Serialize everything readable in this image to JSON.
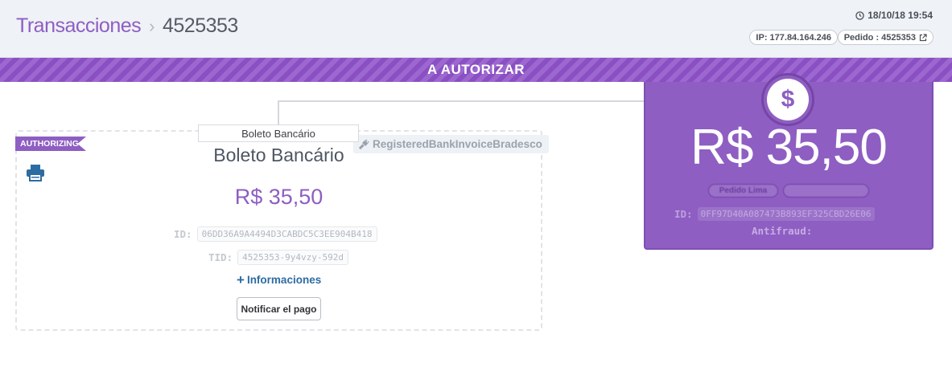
{
  "header": {
    "breadcrumb_root": "Transacciones",
    "breadcrumb_separator": "›",
    "transaction_number": "4525353",
    "datetime": "18/10/18 19:54",
    "ip_label": "IP: 177.84.164.246",
    "order_label": "Pedido : 4525353"
  },
  "status_banner": "A AUTORIZAR",
  "payment": {
    "tab_label": "Boleto Bancário",
    "status_ribbon": "AUTHORIZING",
    "provider": "RegisteredBankInvoiceBradesco",
    "method_title": "Boleto Bancário",
    "amount": "R$ 35,50",
    "id_label": "ID:",
    "id_value": "06DD36A9A4494D3CABDC5C3EE904B418",
    "tid_label": "TID:",
    "tid_value": "4525353-9y4vzy-592d",
    "more_info_label": "Informaciones",
    "notify_button_label": "Notificar el pago"
  },
  "summary": {
    "currency_symbol": "$",
    "amount": "R$ 35,50",
    "pill_status": "Pedido Lima",
    "id_label": "ID:",
    "id_value": "0FF97D40A087473B893EF325CBD26E06",
    "antifraud_label": "Antifraud:"
  },
  "colors": {
    "accent_purple": "#8e5ec2",
    "link_blue": "#2d6ca2",
    "header_bg": "#eff2f7"
  }
}
